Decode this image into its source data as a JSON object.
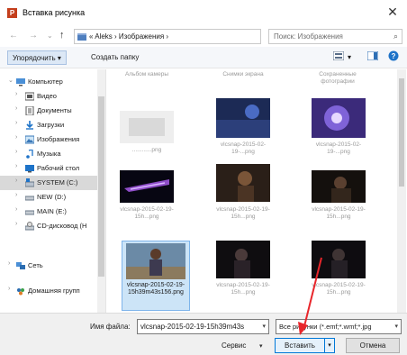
{
  "window": {
    "title": "Вставка рисунка",
    "app_badge": "P",
    "close_glyph": "✕"
  },
  "nav": {
    "back": "←",
    "forward": "→",
    "dropdown": "⌄",
    "up": "↑",
    "address": "« Aleks › Изображения ›",
    "address_dropdown": "⌄",
    "refresh": "↻",
    "search_placeholder": "Поиск: Изображения",
    "search_glyph": "⌕"
  },
  "toolbar": {
    "organize": "Упорядочить ▾",
    "new_folder": "Создать папку",
    "view_dropdown": "▾",
    "help": "?"
  },
  "sidebar": {
    "items": [
      {
        "label": "Компьютер",
        "chevron": "⌄",
        "icon": "computer-icon"
      },
      {
        "label": "Видео",
        "chevron": "›",
        "icon": "video-folder-icon"
      },
      {
        "label": "Документы",
        "chevron": "›",
        "icon": "documents-folder-icon"
      },
      {
        "label": "Загрузки",
        "chevron": "›",
        "icon": "downloads-folder-icon"
      },
      {
        "label": "Изображения",
        "chevron": "›",
        "icon": "pictures-folder-icon"
      },
      {
        "label": "Музыка",
        "chevron": "›",
        "icon": "music-folder-icon"
      },
      {
        "label": "Рабочий стол",
        "chevron": "›",
        "icon": "desktop-folder-icon"
      },
      {
        "label": "SYSTEM (C:)",
        "chevron": "›",
        "icon": "system-drive-icon"
      },
      {
        "label": "NEW (D:)",
        "chevron": "›",
        "icon": "drive-icon"
      },
      {
        "label": "MAIN (E:)",
        "chevron": "›",
        "icon": "drive-icon"
      },
      {
        "label": "CD-дисковод (H",
        "chevron": "›",
        "icon": "cd-drive-icon"
      },
      {
        "label": "Сеть",
        "chevron": "›",
        "icon": "network-icon"
      },
      {
        "label": "Домашняя групп",
        "chevron": "›",
        "icon": "homegroup-icon"
      }
    ]
  },
  "content": {
    "folders": [
      {
        "caption": "Альбом камеры"
      },
      {
        "caption": "Снимки экрана"
      },
      {
        "caption": "Сохраненные фотографии"
      }
    ],
    "files": [
      {
        "caption": "............png"
      },
      {
        "caption": "vlcsnap-2015-02-19-...png"
      },
      {
        "caption": "vlcsnap-2015-02-19-...png"
      },
      {
        "caption": "vlcsnap-2015-02-19-15h...png"
      },
      {
        "caption": "vlcsnap-2015-02-19-15h...png"
      },
      {
        "caption": "vlcsnap-2015-02-19-15h...png"
      },
      {
        "caption": "vlcsnap-2015-02-19-15h39m43s156.png"
      },
      {
        "caption": "vlcsnap-2015-02-19-15h...png"
      },
      {
        "caption": "vlcsnap-2015-02-19-15h...png"
      }
    ]
  },
  "footer": {
    "filename_label": "Имя файла:",
    "filename_value": "vlcsnap-2015-02-19-15h39m43s",
    "filetype_value": "Все рисунки (*.emf;*.wmf;*.jpg",
    "service": "Сервис",
    "insert": "Вставить",
    "cancel": "Отмена",
    "dropdown": "▾"
  }
}
